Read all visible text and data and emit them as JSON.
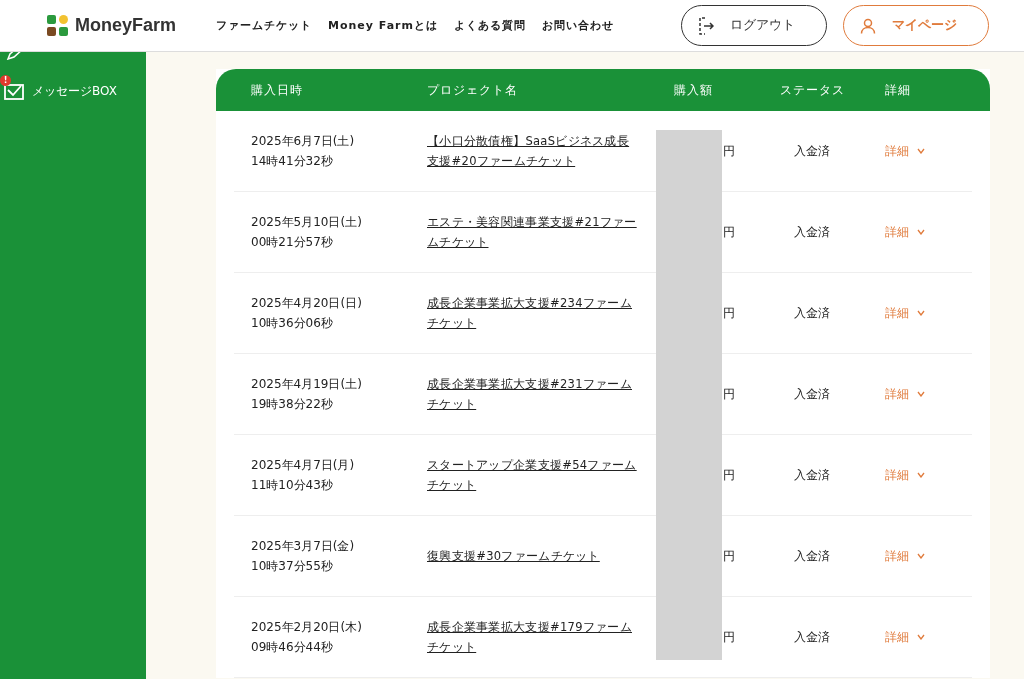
{
  "header": {
    "logo": "MoneyFarm",
    "nav": [
      "ファームチケット",
      "Money Farmとは",
      "よくある質問",
      "お問い合わせ"
    ],
    "logout": "ログアウト",
    "mypage": "マイページ"
  },
  "sidebar": {
    "items": [
      {
        "kind": "message",
        "label": "メッセージBOX",
        "badge": "!"
      }
    ]
  },
  "table": {
    "columns": [
      "購入日時",
      "プロジェクト名",
      "購入額",
      "ステータス",
      "詳細"
    ],
    "rows": [
      {
        "date": "2025年6月7日(土)",
        "time": "14時41分32秒",
        "project": "【小口分散債権】SaaSビジネス成長支援#20ファームチケット",
        "amount": "円",
        "status": "入金済",
        "detail": "詳細"
      },
      {
        "date": "2025年5月10日(土)",
        "time": "00時21分57秒",
        "project": "エステ・美容関連事業支援#21ファームチケット",
        "amount": "円",
        "status": "入金済",
        "detail": "詳細"
      },
      {
        "date": "2025年4月20日(日)",
        "time": "10時36分06秒",
        "project": "成長企業事業拡大支援#234ファームチケット",
        "amount": "円",
        "status": "入金済",
        "detail": "詳細"
      },
      {
        "date": "2025年4月19日(土)",
        "time": "19時38分22秒",
        "project": "成長企業事業拡大支援#231ファームチケット",
        "amount": "円",
        "status": "入金済",
        "detail": "詳細"
      },
      {
        "date": "2025年4月7日(月)",
        "time": "11時10分43秒",
        "project": "スタートアップ企業支援#54ファームチケット",
        "amount": "円",
        "status": "入金済",
        "detail": "詳細"
      },
      {
        "date": "2025年3月7日(金)",
        "time": "10時37分55秒",
        "project": "復興支援#30ファームチケット",
        "amount": "円",
        "status": "入金済",
        "detail": "詳細"
      },
      {
        "date": "2025年2月20日(木)",
        "time": "09時46分44秒",
        "project": "成長企業事業拡大支援#179ファームチケット",
        "amount": "円",
        "status": "入金済",
        "detail": "詳細"
      }
    ]
  }
}
